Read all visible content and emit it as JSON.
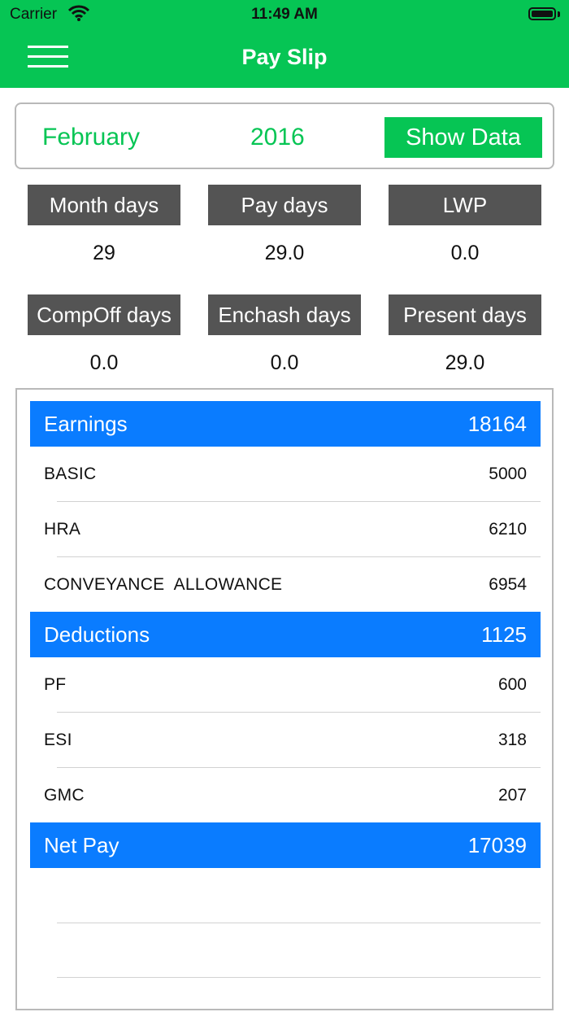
{
  "status_bar": {
    "carrier": "Carrier",
    "time": "11:49 AM"
  },
  "nav": {
    "title": "Pay Slip",
    "menu_icon": "hamburger-icon"
  },
  "selector": {
    "month": "February",
    "year": "2016",
    "show_button": "Show Data"
  },
  "stats": [
    {
      "label": "Month days",
      "value": "29"
    },
    {
      "label": "Pay days",
      "value": "29.0"
    },
    {
      "label": "LWP",
      "value": "0.0"
    },
    {
      "label": "CompOff days",
      "value": "0.0"
    },
    {
      "label": "Enchash days",
      "value": "0.0"
    },
    {
      "label": "Present days",
      "value": "29.0"
    }
  ],
  "earnings": {
    "title": "Earnings",
    "total": "18164",
    "items": [
      {
        "label": "BASIC",
        "value": "5000"
      },
      {
        "label": "HRA",
        "value": "6210"
      },
      {
        "label": "CONVEYANCE  ALLOWANCE",
        "value": "6954"
      }
    ]
  },
  "deductions": {
    "title": "Deductions",
    "total": "1125",
    "items": [
      {
        "label": "PF",
        "value": "600"
      },
      {
        "label": "ESI",
        "value": "318"
      },
      {
        "label": "GMC",
        "value": "207"
      }
    ]
  },
  "net_pay": {
    "title": "Net Pay",
    "total": "17039"
  },
  "colors": {
    "primary_green": "#06c554",
    "section_blue": "#0a7cff",
    "label_gray": "#545454"
  }
}
